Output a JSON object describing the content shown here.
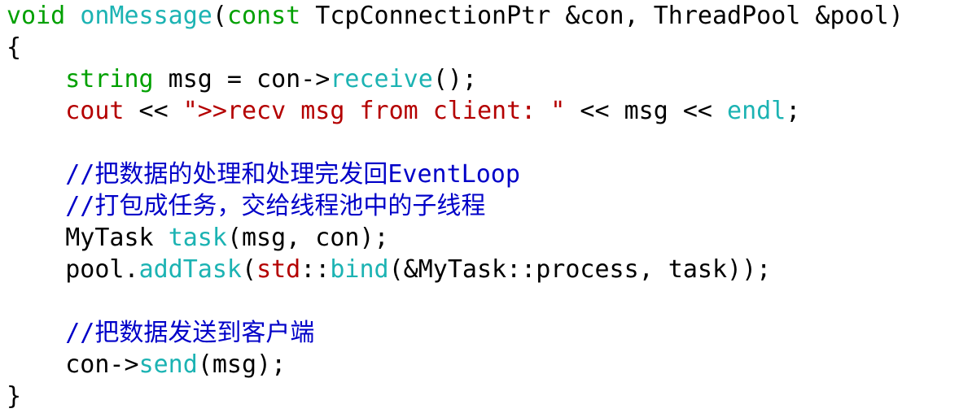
{
  "colors": {
    "background": "#ffffff",
    "default": "#000000",
    "keyword_green": "#00a000",
    "function_cyan": "#1cb3b3",
    "string_red": "#b40000",
    "comment_blue": "#0000c8"
  },
  "code_lines": [
    {
      "tokens": [
        {
          "text": "void ",
          "kind": "keyword"
        },
        {
          "text": "onMessage",
          "kind": "function"
        },
        {
          "text": "(",
          "kind": "default"
        },
        {
          "text": "const",
          "kind": "keyword"
        },
        {
          "text": " TcpConnectionPtr &con, ThreadPool &pool)",
          "kind": "default"
        }
      ]
    },
    {
      "tokens": [
        {
          "text": "{",
          "kind": "default"
        }
      ]
    },
    {
      "tokens": [
        {
          "text": "    ",
          "kind": "default"
        },
        {
          "text": "string",
          "kind": "keyword"
        },
        {
          "text": " msg = con->",
          "kind": "default"
        },
        {
          "text": "receive",
          "kind": "function"
        },
        {
          "text": "();",
          "kind": "default"
        }
      ]
    },
    {
      "tokens": [
        {
          "text": "    ",
          "kind": "default"
        },
        {
          "text": "cout",
          "kind": "string"
        },
        {
          "text": " << ",
          "kind": "default"
        },
        {
          "text": "\">>recv msg from client: \"",
          "kind": "string"
        },
        {
          "text": " << msg << ",
          "kind": "default"
        },
        {
          "text": "endl",
          "kind": "function"
        },
        {
          "text": ";",
          "kind": "default"
        }
      ]
    },
    {
      "tokens": []
    },
    {
      "tokens": [
        {
          "text": "    ",
          "kind": "default"
        },
        {
          "text": "//把数据的处理和处理完发回EventLoop",
          "kind": "comment"
        }
      ]
    },
    {
      "tokens": [
        {
          "text": "    ",
          "kind": "default"
        },
        {
          "text": "//打包成任务，交给线程池中的子线程",
          "kind": "comment"
        }
      ]
    },
    {
      "tokens": [
        {
          "text": "    MyTask ",
          "kind": "default"
        },
        {
          "text": "task",
          "kind": "function"
        },
        {
          "text": "(msg, con);",
          "kind": "default"
        }
      ]
    },
    {
      "tokens": [
        {
          "text": "    pool.",
          "kind": "default"
        },
        {
          "text": "addTask",
          "kind": "function"
        },
        {
          "text": "(",
          "kind": "default"
        },
        {
          "text": "std",
          "kind": "string"
        },
        {
          "text": "::",
          "kind": "default"
        },
        {
          "text": "bind",
          "kind": "function"
        },
        {
          "text": "(&MyTask::process, task));",
          "kind": "default"
        }
      ]
    },
    {
      "tokens": []
    },
    {
      "tokens": [
        {
          "text": "    ",
          "kind": "default"
        },
        {
          "text": "//把数据发送到客户端",
          "kind": "comment"
        }
      ]
    },
    {
      "tokens": [
        {
          "text": "    con->",
          "kind": "default"
        },
        {
          "text": "send",
          "kind": "function"
        },
        {
          "text": "(msg);",
          "kind": "default"
        }
      ]
    },
    {
      "tokens": [
        {
          "text": "}",
          "kind": "default"
        }
      ]
    }
  ]
}
